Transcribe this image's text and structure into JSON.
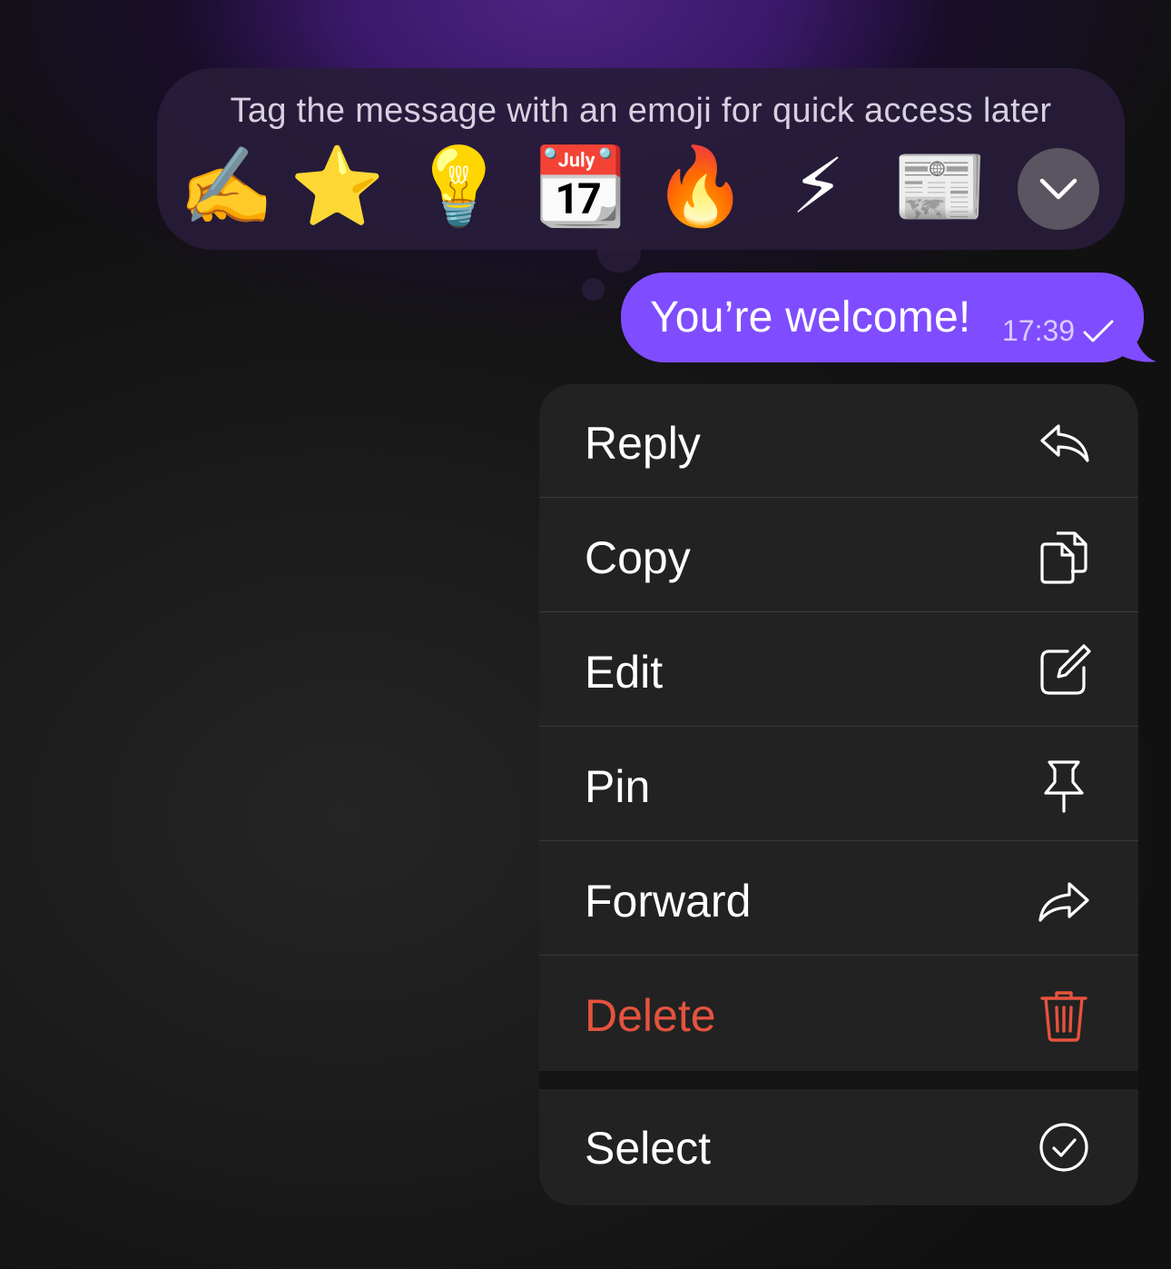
{
  "tag_bar": {
    "title": "Tag the message with an emoji for quick access later",
    "emojis": [
      {
        "char": "✍️",
        "icon": "writing-hand-emoji"
      },
      {
        "char": "⭐",
        "icon": "star-emoji"
      },
      {
        "char": "💡",
        "icon": "light-bulb-emoji"
      },
      {
        "char": "📆",
        "icon": "calendar-emoji"
      },
      {
        "char": "🔥",
        "icon": "fire-emoji"
      },
      {
        "char": "⚡",
        "icon": "lightning-emoji"
      },
      {
        "char": "📰",
        "icon": "newspaper-emoji"
      }
    ],
    "expand_icon": "chevron-down-icon"
  },
  "message": {
    "text": "You’re welcome!",
    "time": "17:39",
    "status_icon": "checkmark-icon",
    "color": "#7f4dff"
  },
  "menu": {
    "items": [
      {
        "label": "Reply",
        "icon": "reply-icon"
      },
      {
        "label": "Copy",
        "icon": "copy-icon"
      },
      {
        "label": "Edit",
        "icon": "edit-icon"
      },
      {
        "label": "Pin",
        "icon": "pin-icon"
      },
      {
        "label": "Forward",
        "icon": "forward-icon"
      },
      {
        "label": "Delete",
        "icon": "trash-icon",
        "color": "#e5533e"
      }
    ],
    "select": {
      "label": "Select",
      "icon": "checkmark-circle-icon"
    }
  }
}
